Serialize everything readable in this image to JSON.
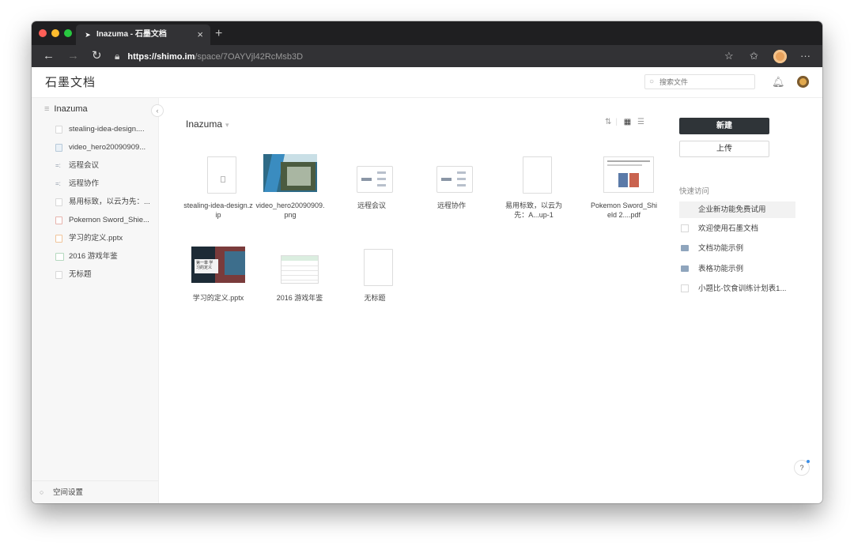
{
  "browser": {
    "tab_title": "Inazuma - 石墨文档",
    "tab_close": "×",
    "new_tab": "+",
    "url_scheme": "https://",
    "url_host": "shimo.im",
    "url_path": "/space/7OAYVjl42RcMsb3D",
    "icons": {
      "back": "←",
      "forward": "→",
      "reload": "↻",
      "lock": "🔒︎",
      "star": "☆",
      "favorites": "✩",
      "more": "···"
    },
    "traffic_lights": {
      "close": "#fe5f57",
      "minimize": "#febc2e",
      "maximize": "#28c840"
    }
  },
  "app": {
    "logo": "石墨文档",
    "search_placeholder": "搜索文件",
    "bell_icon": "♢"
  },
  "sidebar": {
    "space_title": "Inazuma",
    "items": [
      {
        "label": "stealing-idea-design....",
        "icon": "file-icon"
      },
      {
        "label": "video_hero20090909...",
        "icon": "image-icon"
      },
      {
        "label": "远程会议",
        "icon": "mindmap-icon"
      },
      {
        "label": "远程协作",
        "icon": "mindmap-icon"
      },
      {
        "label": "易用标致，以云为先：...",
        "icon": "doc-icon"
      },
      {
        "label": "Pokemon Sword_Shie...",
        "icon": "pdf-icon"
      },
      {
        "label": "学习的定义.pptx",
        "icon": "ppt-icon"
      },
      {
        "label": "2016 游戏年鉴",
        "icon": "sheet-icon"
      },
      {
        "label": "无标题",
        "icon": "doc-icon"
      }
    ],
    "settings_label": "空间设置"
  },
  "main": {
    "breadcrumb": "Inazuma",
    "breadcrumb_caret": "▾",
    "files": [
      {
        "name": "stealing-idea-design.zip",
        "type": "zip"
      },
      {
        "name": "video_hero20090909.png",
        "type": "image"
      },
      {
        "name": "远程会议",
        "type": "mindmap"
      },
      {
        "name": "远程协作",
        "type": "mindmap"
      },
      {
        "name": "易用标致，以云为先：A...up-1",
        "type": "doc"
      },
      {
        "name": "Pokemon Sword_Shield 2....pdf",
        "type": "pdf"
      },
      {
        "name": "学习的定义.pptx",
        "type": "ppt"
      },
      {
        "name": "2016 游戏年鉴",
        "type": "sheet"
      },
      {
        "name": "无标题",
        "type": "doc"
      }
    ],
    "thumb_text": {
      "ppt_card": "第一章 学习的定义"
    }
  },
  "rightpanel": {
    "new_button": "新建",
    "upload_button": "上传",
    "quick_access_title": "快速访问",
    "quick_access": [
      {
        "label": "企业新功能免费试用",
        "icon": "none"
      },
      {
        "label": "欢迎使用石墨文档",
        "icon": "doc-icon"
      },
      {
        "label": "文档功能示例",
        "icon": "folder-icon"
      },
      {
        "label": "表格功能示例",
        "icon": "folder-icon"
      },
      {
        "label": "小题比-饮食训练计划表1...",
        "icon": "sheet-icon"
      }
    ]
  },
  "help_label": "?"
}
